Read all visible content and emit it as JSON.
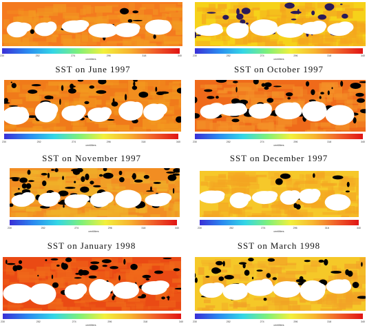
{
  "captions": [
    "SST on June 1997",
    "SST on October 1997",
    "SST on November 1997",
    "SST on December 1997",
    "SST on January 1998",
    "SST on March 1998"
  ],
  "colorbar": {
    "ticks": [
      "230",
      "252",
      "274",
      "296",
      "318",
      "340"
    ],
    "unit": "centiliters",
    "colors": [
      "#3a2fd6",
      "#2a8af0",
      "#33d6e6",
      "#7ef07a",
      "#f2f03c",
      "#f7b530",
      "#f0602a",
      "#e01414"
    ]
  },
  "panels": [
    {
      "fill": [
        "#f47a1e",
        "#f39a22"
      ],
      "cloud": "#000000",
      "cloud_level": 0.05
    },
    {
      "fill": [
        "#f6d21a",
        "#f4a51e"
      ],
      "cloud": "#2a1a5a",
      "cloud_level": 0.12
    },
    {
      "fill": [
        "#f07a1a",
        "#f39a20"
      ],
      "cloud": "#000000",
      "cloud_level": 0.18
    },
    {
      "fill": [
        "#ef6a1a",
        "#f49228"
      ],
      "cloud": "#000000",
      "cloud_level": 0.22
    },
    {
      "fill": [
        "#f28d22",
        "#f0b22a"
      ],
      "cloud": "#000000",
      "cloud_level": 0.3
    },
    {
      "fill": [
        "#f6c82a",
        "#f4a522"
      ],
      "cloud": "#000000",
      "cloud_level": 0.05
    },
    {
      "fill": [
        "#ea4a14",
        "#f06a1a"
      ],
      "cloud": "#000000",
      "cloud_level": 0.2
    },
    {
      "fill": [
        "#f5c828",
        "#f2a226"
      ],
      "cloud": "#000000",
      "cloud_level": 0.15
    }
  ]
}
